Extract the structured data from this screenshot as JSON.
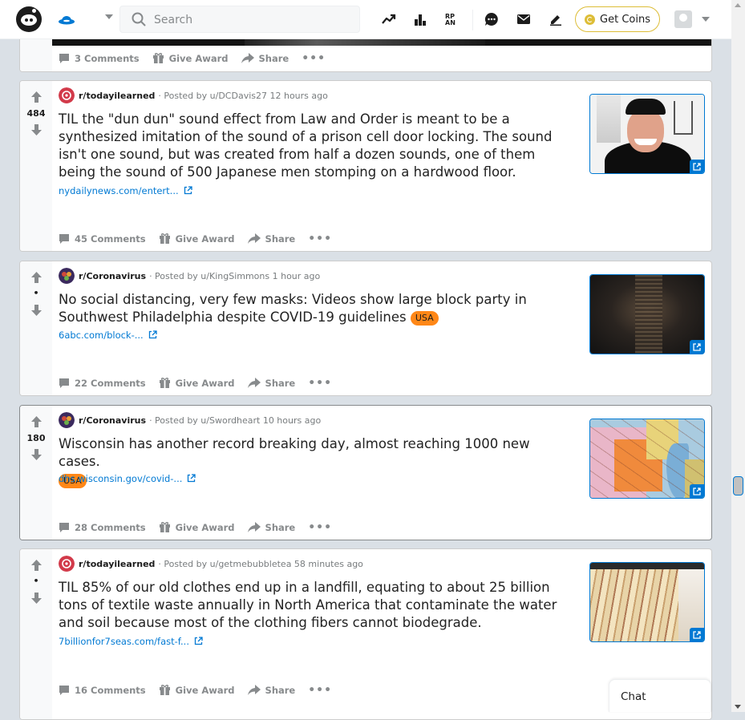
{
  "header": {
    "search_placeholder": "Search",
    "get_coins_label": "Get Coins",
    "icons": [
      "home-icon",
      "popular-icon",
      "leaderboard-icon",
      "rpan-icon",
      "chat-icon",
      "mail-icon",
      "create-post-icon"
    ]
  },
  "top_card": {
    "actions": {
      "comments": "3 Comments",
      "award": "Give Award",
      "share": "Share"
    }
  },
  "posts": [
    {
      "score": "484",
      "subreddit": "r/todayilearned",
      "posted_by": "· Posted by u/DCDavis27 12 hours ago",
      "title": "TIL the \"dun dun\" sound effect from Law and Order is meant to be a synthesized imitation of the sound of a prison cell door locking. The sound isn't one sound, but was created from half a dozen sounds, one of them being the sound of 500 Japanese men stomping on a hardwood floor.",
      "flair": "",
      "link": "nydailynews.com/entert...",
      "comments": "45 Comments",
      "award": "Give Award",
      "share": "Share"
    },
    {
      "score": "•",
      "subreddit": "r/Coronavirus",
      "posted_by": "· Posted by u/KingSimmons 1 hour ago",
      "title": "No social distancing, very few masks: Videos show large block party in Southwest Philadelphia despite COVID-19 guidelines",
      "flair": "USA",
      "link": "6abc.com/block-...",
      "comments": "22 Comments",
      "award": "Give Award",
      "share": "Share"
    },
    {
      "score": "180",
      "subreddit": "r/Coronavirus",
      "posted_by": "· Posted by u/Swordheart 10 hours ago",
      "title": "Wisconsin has another record breaking day, almost reaching 1000 new cases.",
      "flair": "USA",
      "link": "dhs.wisconsin.gov/covid-...",
      "comments": "28 Comments",
      "award": "Give Award",
      "share": "Share"
    },
    {
      "score": "•",
      "subreddit": "r/todayilearned",
      "posted_by": "· Posted by u/getmebubbletea 58 minutes ago",
      "title": "TIL 85% of our old clothes end up in a landfill, equating to about 25 billion tons of textile waste annually in North America that contaminate the water and soil because most of the clothing fibers cannot biodegrade.",
      "flair": "",
      "link": "7billionfor7seas.com/fast-f...",
      "comments": "16 Comments",
      "award": "Give Award",
      "share": "Share"
    }
  ],
  "chat": {
    "label": "Chat"
  },
  "colors": {
    "accent_blue": "#0079d3",
    "flair_orange": "#ff8717",
    "coin_gold": "#ddbd37",
    "page_bg": "#dae0e6"
  }
}
